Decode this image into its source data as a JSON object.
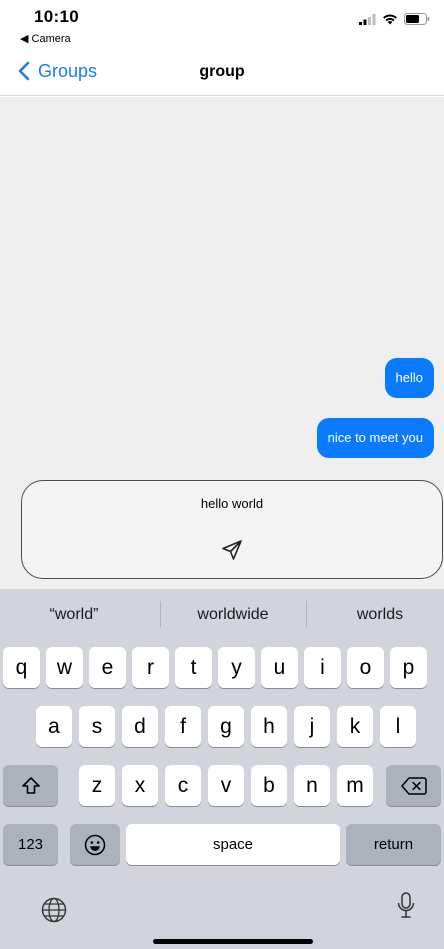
{
  "status_bar": {
    "time": "10:10",
    "back_app": "◀ Camera"
  },
  "nav": {
    "back_label": "Groups",
    "title": "group"
  },
  "messages": [
    {
      "text": "hello"
    },
    {
      "text": "nice to meet you"
    }
  ],
  "composer": {
    "value": "hello world"
  },
  "keyboard": {
    "suggestions": [
      "“world”",
      "worldwide",
      "worlds"
    ],
    "row1": [
      "q",
      "w",
      "e",
      "r",
      "t",
      "y",
      "u",
      "i",
      "o",
      "p"
    ],
    "row2": [
      "a",
      "s",
      "d",
      "f",
      "g",
      "h",
      "j",
      "k",
      "l"
    ],
    "row3": [
      "z",
      "x",
      "c",
      "v",
      "b",
      "n",
      "m"
    ],
    "numbers_label": "123",
    "space_label": "space",
    "return_label": "return"
  },
  "colors": {
    "accent": "#1a7cf5",
    "bubble": "#0a7aff",
    "chat_bg": "#efefef",
    "keyboard_bg": "#d1d4da"
  }
}
